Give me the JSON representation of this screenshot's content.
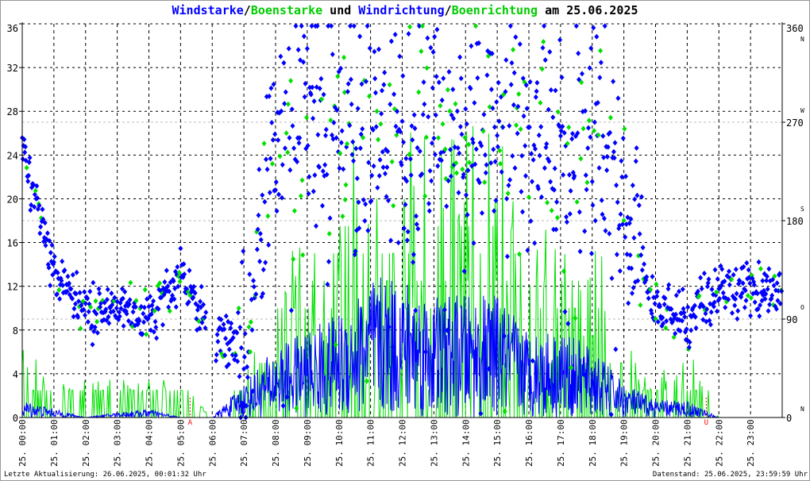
{
  "title": {
    "part1": "Windstarke",
    "sep1": "/",
    "part2": "Boenstarke",
    "mid": " und ",
    "part3": "Windrichtung",
    "sep2": "/",
    "part4": "Boenrichtung",
    "date": " am 25.06.2025"
  },
  "footer": {
    "left": "Letzte Aktualisierung: 26.06.2025, 00:01:32 Uhr",
    "right": "Datenstand: 25.06.2025, 23:59:59 Uhr"
  },
  "colors": {
    "wind": "#0000ff",
    "gust": "#00e000",
    "marker": "#ff0000"
  },
  "chart_data": {
    "type": "line+scatter",
    "title": "Windstarke/Boenstarke und Windrichtung/Boenrichtung am 25.06.2025",
    "x_tick_labels": [
      "25. 00:00",
      "25. 01:00",
      "25. 02:00",
      "25. 03:00",
      "25. 04:00",
      "25. 05:00",
      "25. 06:00",
      "25. 07:00",
      "25. 08:00",
      "25. 09:00",
      "25. 10:00",
      "25. 11:00",
      "25. 12:00",
      "25. 13:00",
      "25. 14:00",
      "25. 15:00",
      "25. 16:00",
      "25. 17:00",
      "25. 18:00",
      "25. 19:00",
      "25. 20:00",
      "25. 21:00",
      "25. 22:00",
      "25. 23:00"
    ],
    "left_axis": {
      "ylim": [
        0,
        36
      ],
      "ticks": [
        0,
        4,
        8,
        12,
        16,
        20,
        24,
        28,
        32,
        36
      ]
    },
    "right_axis": {
      "ylim": [
        0,
        360
      ],
      "ticks": [
        0,
        90,
        180,
        270,
        360
      ],
      "compass": [
        "N",
        "O",
        "S",
        "W",
        "N"
      ]
    },
    "markers": [
      {
        "label": "A",
        "hour": 5.3
      },
      {
        "label": "U",
        "hour": 21.6
      }
    ],
    "hours": [
      0,
      1,
      2,
      3,
      4,
      5,
      6,
      7,
      8,
      9,
      10,
      11,
      12,
      13,
      14,
      15,
      16,
      17,
      18,
      19,
      20,
      21,
      22,
      23
    ],
    "series": [
      {
        "name": "Windstarke",
        "values": [
          1,
          0.5,
          0,
          0.3,
          0.5,
          0,
          0,
          2,
          4,
          5,
          6,
          8,
          8,
          7,
          7,
          7,
          5,
          5,
          4,
          2,
          1,
          1,
          0,
          0
        ]
      },
      {
        "name": "Boenstarke",
        "values": [
          5,
          2.5,
          2.5,
          2.5,
          2.5,
          2.5,
          0,
          2.5,
          10,
          13,
          18,
          20,
          20,
          18,
          20,
          20,
          13,
          13,
          13,
          5,
          2.5,
          5,
          0,
          0
        ]
      },
      {
        "name": "Windrichtung",
        "values": [
          250,
          130,
          95,
          105,
          90,
          130,
          80,
          60,
          260,
          265,
          265,
          260,
          255,
          260,
          265,
          265,
          260,
          255,
          245,
          200,
          100,
          90,
          120,
          115
        ]
      }
    ],
    "grid": true
  }
}
